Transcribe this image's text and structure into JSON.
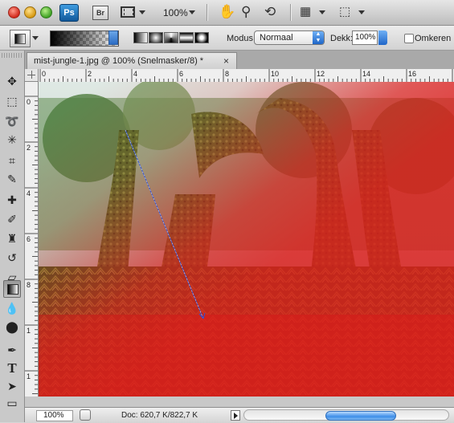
{
  "app": {
    "logo_text": "Ps",
    "bridge_text": "Br",
    "zoom_display": "100%"
  },
  "options": {
    "modus_label": "Modus:",
    "modus_value": "Normaal",
    "dekking_label": "Dekk:",
    "dekking_value": "100%",
    "omkeren_label": "Omkeren",
    "omkeren_checked": false
  },
  "document": {
    "tab_title": "mist-jungle-1.jpg @ 100% (Snelmasker/8) *",
    "close_glyph": "×"
  },
  "rulers": {
    "h_labels": [
      "0",
      "2",
      "4",
      "6",
      "8",
      "10",
      "12",
      "14",
      "16"
    ],
    "v_labels": [
      "0",
      "2",
      "4",
      "6",
      "8",
      "1",
      "1",
      "1"
    ]
  },
  "status": {
    "zoom": "100%",
    "doc_info": "Doc: 620,7 K/822,7 K",
    "scroll_position": 0.6
  },
  "colors": {
    "quickmask_overlay": "#e01b1b",
    "jungle_green": "#4f7b3a",
    "scroll_accent": "#3e8ee8"
  },
  "tools": [
    "move-tool",
    "marquee-tool",
    "lasso-tool",
    "magic-wand-tool",
    "crop-tool",
    "eyedropper-tool",
    "healing-brush-tool",
    "brush-tool",
    "clone-stamp-tool",
    "history-brush-tool",
    "eraser-tool",
    "gradient-tool",
    "blur-tool",
    "dodge-tool",
    "pen-tool",
    "type-tool",
    "path-selection-tool",
    "shape-tool"
  ]
}
